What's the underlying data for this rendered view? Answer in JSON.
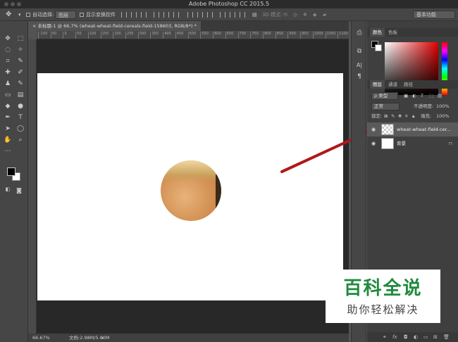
{
  "window": {
    "title": "Adobe Photoshop CC 2015.5"
  },
  "options_bar": {
    "auto_select_label": "自动选择:",
    "auto_select_value": "图层",
    "show_transform_label": "显示变换控件",
    "mode_3d_label": "3D 模式:",
    "workspace": "基本功能"
  },
  "document": {
    "tab_title": "未标题-1 @ 66.7% (wheat-wheat-field-cereals-field-158603, RGB/8*) *",
    "ruler_ticks": [
      "-100",
      "50",
      "0",
      "50",
      "100",
      "150",
      "200",
      "250",
      "300",
      "350",
      "400",
      "450",
      "500",
      "550",
      "600",
      "650",
      "700",
      "750",
      "800",
      "850",
      "900",
      "950",
      "1000",
      "1050",
      "1100"
    ]
  },
  "status": {
    "zoom": "66.67%",
    "doc_size": "文档:2.98M/5.00M"
  },
  "color_panel": {
    "tabs": [
      "颜色",
      "色板"
    ],
    "fg_color": "#000000",
    "bg_color": "#ffffff"
  },
  "layers_panel": {
    "tabs": [
      "图层",
      "通道",
      "路径"
    ],
    "filter_kind": "ρ 类型",
    "blend_mode": "正常",
    "opacity_label": "不透明度:",
    "opacity_value": "100%",
    "lock_label": "锁定:",
    "fill_label": "填充:",
    "fill_value": "100%",
    "layers": [
      {
        "name": "wheat-wheat-field-cer...",
        "visible": true,
        "selected": true
      },
      {
        "name": "背景",
        "visible": true,
        "selected": false,
        "locked": true
      }
    ],
    "bottom_icons": [
      "link-icon",
      "fx-icon",
      "mask-icon",
      "adjustment-icon",
      "group-icon",
      "new-layer-icon",
      "trash-icon"
    ]
  },
  "watermark": {
    "title": "百科全说",
    "subtitle": "助你轻松解决"
  },
  "colors": {
    "arrow": "#b01818",
    "watermark_green": "#1f8a3d"
  }
}
